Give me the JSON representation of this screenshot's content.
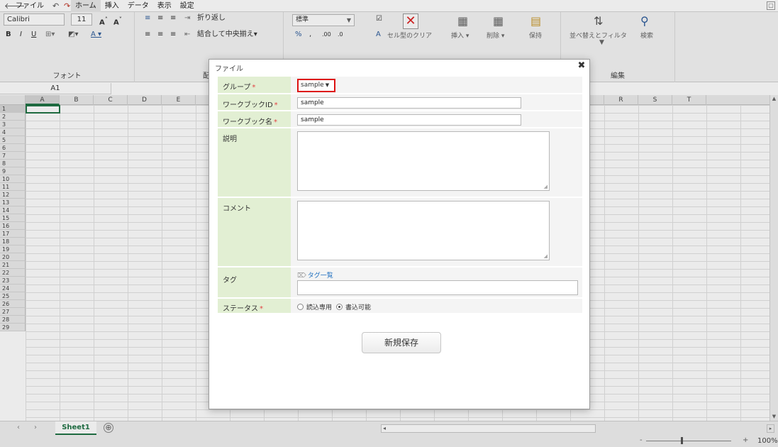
{
  "menubar": {
    "items": [
      "ファイル",
      "ホーム",
      "挿入",
      "データ",
      "表示",
      "設定"
    ]
  },
  "ribbon": {
    "font": {
      "name": "Calibri",
      "size": "11",
      "group_title": "フォント"
    },
    "alignment": {
      "wrap_text": "折り返し",
      "merge_center": "結合して中央揃え▾",
      "group_title_fragment": "配"
    },
    "number": {
      "format": "標準"
    },
    "cells": {
      "clear_format": "セル型のクリア",
      "insert": "挿入 ▾",
      "delete": "削除 ▾",
      "format": "保持"
    },
    "editing": {
      "sort_filter": "並べ替えとフィルタ",
      "search": "検索",
      "group_title": "編集"
    }
  },
  "formula_bar": {
    "name_box": "A1"
  },
  "grid": {
    "columns": [
      "A",
      "B",
      "C",
      "D",
      "E",
      "",
      "",
      "",
      "",
      "",
      "",
      "",
      "",
      "",
      "",
      "",
      "",
      "R",
      "S",
      "T"
    ],
    "rows": [
      "1",
      "2",
      "3",
      "4",
      "5",
      "6",
      "7",
      "8",
      "9",
      "10",
      "11",
      "12",
      "13",
      "14",
      "15",
      "16",
      "17",
      "18",
      "19",
      "20",
      "21",
      "22",
      "23",
      "24",
      "25",
      "26",
      "27",
      "28",
      "29"
    ]
  },
  "sheets": {
    "active": "Sheet1",
    "add_symbol": "⊕"
  },
  "status": {
    "zoom": "100%",
    "minus": "-",
    "plus": "+"
  },
  "dialog": {
    "title": "ファイル",
    "close": "✖",
    "fields": {
      "group": {
        "label": "グループ",
        "required": "*",
        "value": "sample"
      },
      "workbook_id": {
        "label": "ワークブックID",
        "required": "*",
        "value": "sample"
      },
      "workbook_name": {
        "label": "ワークブック名",
        "required": "*",
        "value": "sample"
      },
      "description": {
        "label": "説明",
        "value": ""
      },
      "comment": {
        "label": "コメント",
        "value": ""
      },
      "tag": {
        "label": "タグ",
        "link": "タグ一覧",
        "value": ""
      },
      "status": {
        "label": "ステータス",
        "required": "*",
        "options": [
          "読込専用",
          "書込可能"
        ],
        "selected": "書込可能"
      }
    },
    "save_button": "新規保存"
  },
  "colors": {
    "accent": "#217346",
    "label_bg": "#e2efd3",
    "required": "#e24343",
    "highlight": "#dd1111",
    "link": "#1f6fbf"
  }
}
